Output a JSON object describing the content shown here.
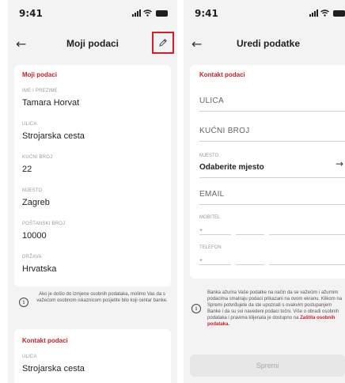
{
  "left": {
    "status_time": "9:41",
    "nav_title": "Moji podaci",
    "section_title": "Moji podaci",
    "fields": [
      {
        "label": "IME I PREZIME",
        "value": "Tamara Horvat"
      },
      {
        "label": "ULICA",
        "value": "Strojarska cesta"
      },
      {
        "label": "KUĆNI BROJ",
        "value": "22"
      },
      {
        "label": "MJESTO",
        "value": "Zagreb"
      },
      {
        "label": "POŠTANSKI BROJ",
        "value": "10000"
      },
      {
        "label": "DRŽAVA",
        "value": "Hrvatska"
      }
    ],
    "info_text": "Ako je došlo do izmjene osobnih podataka, molimo Vas da s važećom osobnom iskaznicom posjetite bilo koji centar banke.",
    "contact_title": "Kontakt podaci",
    "contact_fields": [
      {
        "label": "ULICA",
        "value": "Strojarska cesta"
      }
    ]
  },
  "right": {
    "status_time": "9:41",
    "nav_title": "Uredi podatke",
    "section_title": "Kontakt podaci",
    "street_label": "ULICA",
    "house_label": "KUĆNI BROJ",
    "place_label": "MJESTO",
    "place_value": "Odaberite mjesto",
    "email_label": "EMAIL",
    "mobile_label": "MOBITEL",
    "phone_label": "TELEFON",
    "plus_sign": "+",
    "info_text": "Banka ažurira Vaše podatke na način da se važećim i ažurnim podacima smatraju podaci prikazani na ovom ekranu. Klikom na Spremi potvrđujete da ste upoznati s ovakvim postupanjem Banke i da su svi navedeni podaci točni. Više o obradi osobnih podataka i pravima klijenata je dostupno na",
    "info_link": "Zaštita osobnih podataka.",
    "save_label": "Spremi"
  },
  "icons": {
    "back": "arrow-left-icon",
    "edit": "pencil-icon",
    "info": "info-circle-icon",
    "forward": "arrow-right-icon"
  },
  "colors": {
    "accent": "#c81e2b",
    "highlight_box": "#d81e2b",
    "background": "#f3f3f4"
  }
}
